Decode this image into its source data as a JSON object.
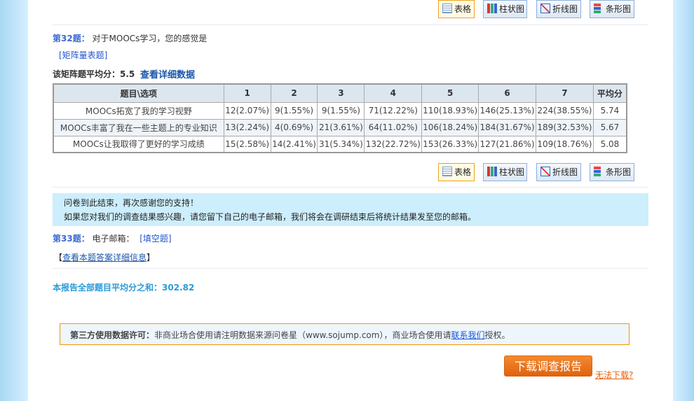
{
  "view_buttons": [
    {
      "label": "表格",
      "icon": "table-icon"
    },
    {
      "label": "柱状图",
      "icon": "bar-chart-icon"
    },
    {
      "label": "折线图",
      "icon": "line-chart-icon"
    },
    {
      "label": "条形图",
      "icon": "horizontal-bar-icon"
    }
  ],
  "q32": {
    "num": "第32题：",
    "title": "对于MOOCs学习，您的感觉是",
    "type": "[矩阵量表题]",
    "avg_label": "该矩阵题平均分：5.5",
    "detail_link": "查看详细数据",
    "headers": [
      "题目\\选项",
      "1",
      "2",
      "3",
      "4",
      "5",
      "6",
      "7",
      "平均分"
    ],
    "rows": [
      [
        "MOOCs拓宽了我的学习视野",
        "12(2.07%)",
        "9(1.55%)",
        "9(1.55%)",
        "71(12.22%)",
        "110(18.93%)",
        "146(25.13%)",
        "224(38.55%)",
        "5.74"
      ],
      [
        "MOOCs丰富了我在一些主题上的专业知识",
        "13(2.24%)",
        "4(0.69%)",
        "21(3.61%)",
        "64(11.02%)",
        "106(18.24%)",
        "184(31.67%)",
        "189(32.53%)",
        "5.67"
      ],
      [
        "MOOCs让我取得了更好的学习成绩",
        "15(2.58%)",
        "14(2.41%)",
        "31(5.34%)",
        "132(22.72%)",
        "153(26.33%)",
        "127(21.86%)",
        "109(18.76%)",
        "5.08"
      ]
    ]
  },
  "end_box": {
    "line1": "问卷到此结束，再次感谢您的支持！",
    "line2": "如果您对我们的调查结果感兴趣，请您留下自己的电子邮箱，我们将会在调研结束后将统计结果发至您的邮箱。"
  },
  "q33": {
    "num": "第33题：",
    "title": "电子邮箱：",
    "type": "[填空题]",
    "detail_open": "【",
    "detail_link": "查看本题答案详细信息",
    "detail_close": "】"
  },
  "total": "本报告全部题目平均分之和：302.82",
  "license": {
    "label": "第三方使用数据许可：",
    "text": "非商业场合使用请注明数据来源问卷星（www.sojump.com），商业场合使用请",
    "link": "联系我们",
    "tail": "授权。"
  },
  "download": {
    "button": "下载调查报告",
    "help": "无法下载?"
  }
}
